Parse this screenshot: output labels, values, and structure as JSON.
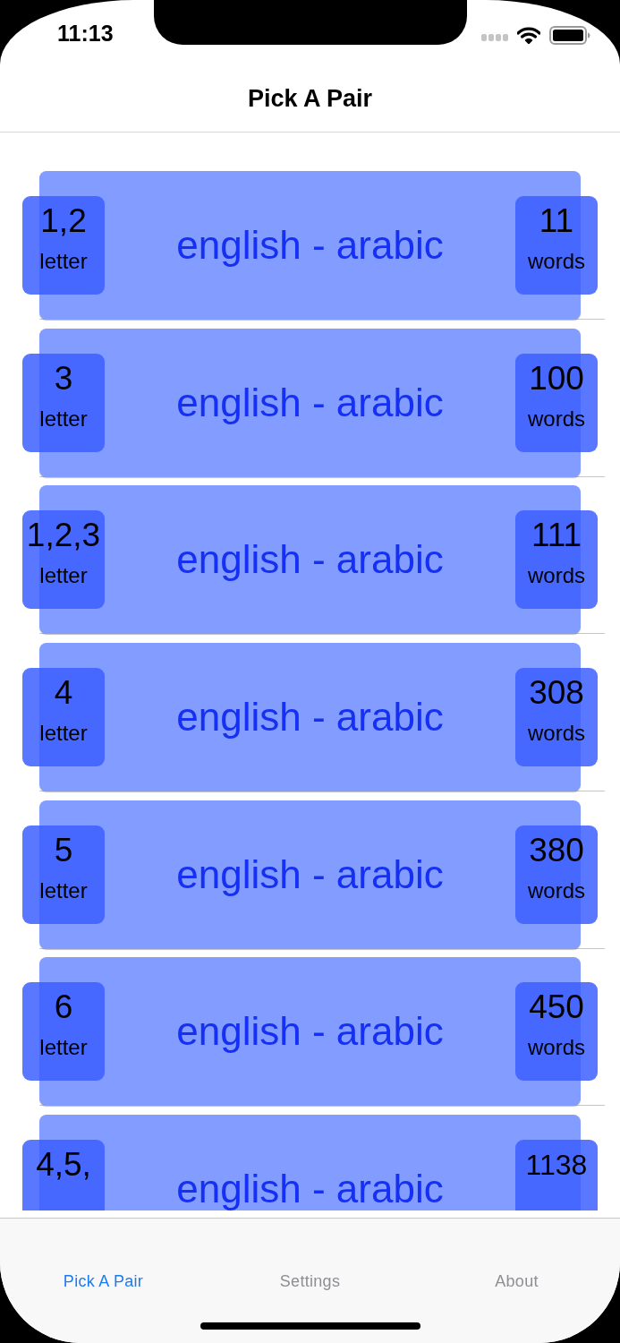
{
  "status_bar": {
    "time": "11:13"
  },
  "nav_bar": {
    "title": "Pick A Pair"
  },
  "pairs": [
    {
      "letters": "1,2",
      "letters_unit": "letter",
      "title": "english - arabic",
      "words": "11",
      "words_unit": "words"
    },
    {
      "letters": "3",
      "letters_unit": "letter",
      "title": "english - arabic",
      "words": "100",
      "words_unit": "words"
    },
    {
      "letters": "1,2,3",
      "letters_unit": "letter",
      "title": "english - arabic",
      "words": "111",
      "words_unit": "words"
    },
    {
      "letters": "4",
      "letters_unit": "letter",
      "title": "english - arabic",
      "words": "308",
      "words_unit": "words"
    },
    {
      "letters": "5",
      "letters_unit": "letter",
      "title": "english - arabic",
      "words": "380",
      "words_unit": "words"
    },
    {
      "letters": "6",
      "letters_unit": "letter",
      "title": "english - arabic",
      "words": "450",
      "words_unit": "words"
    },
    {
      "letters": "4,5,",
      "title": "english - arabic",
      "words": "1138"
    }
  ],
  "tab_bar": {
    "tabs": [
      {
        "label": "Pick A Pair",
        "selected": true
      },
      {
        "label": "Settings",
        "selected": false
      },
      {
        "label": "About",
        "selected": false
      }
    ]
  }
}
